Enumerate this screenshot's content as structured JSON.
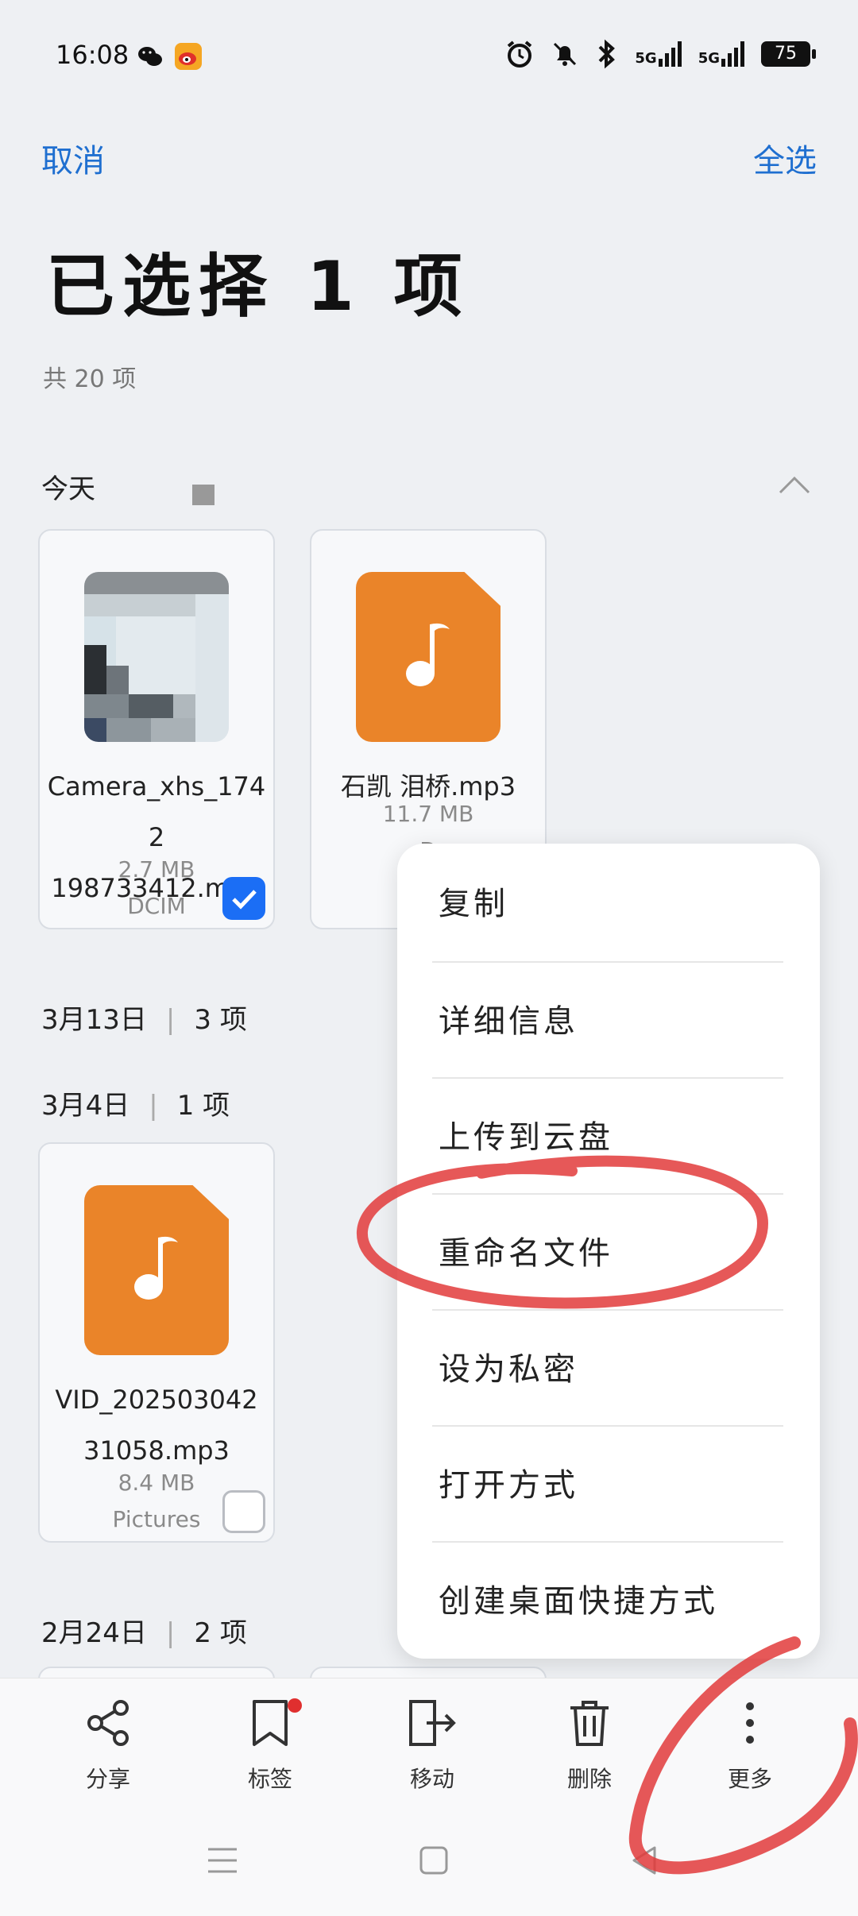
{
  "status_bar": {
    "time": "16:08",
    "battery": "75",
    "signal_1": "5G",
    "signal_2": "5G",
    "icons": [
      "wechat-icon",
      "weibo-icon",
      "alarm-icon",
      "mute-icon",
      "bluetooth-icon",
      "signal-icon",
      "signal-icon",
      "battery-icon"
    ]
  },
  "header": {
    "cancel_label": "取消",
    "select_all_label": "全选",
    "title": "已选择 1 项",
    "subtitle": "共 20 项"
  },
  "sections": [
    {
      "label": "今天",
      "files": [
        {
          "name": "Camera_xhs_1742198733412.mp4",
          "name_line1": "Camera_xhs_1742",
          "name_line2": "198733412.mp4",
          "size": "2.7 MB",
          "location": "DCIM",
          "selected": true,
          "thumb": "video-thumbnail"
        },
        {
          "name": "石凯 泪桥.mp3",
          "name_line1": "石凯 泪桥.mp3",
          "size": "11.7 MB",
          "location": "D",
          "selected": false,
          "thumb": "music-file-icon"
        }
      ]
    },
    {
      "label": "3月13日",
      "count": "3 项"
    },
    {
      "label": "3月4日",
      "count": "1 项",
      "files": [
        {
          "name": "VID_20250304231058.mp3",
          "name_line1": "VID_202503042",
          "name_line2": "31058.mp3",
          "size": "8.4 MB",
          "location": "Pictures",
          "selected": false,
          "thumb": "music-file-icon"
        }
      ]
    },
    {
      "label": "2月24日",
      "count": "2 项"
    }
  ],
  "context_menu": {
    "items": [
      "复制",
      "详细信息",
      "上传到云盘",
      "重命名文件",
      "设为私密",
      "打开方式",
      "创建桌面快捷方式"
    ]
  },
  "toolbar": {
    "share_label": "分享",
    "tag_label": "标签",
    "move_label": "移动",
    "delete_label": "删除",
    "more_label": "更多"
  },
  "colors": {
    "accent": "#1f6fd0",
    "checkbox": "#1b6ef5",
    "music_icon": "#ea8429",
    "annotation": "#e23b3b"
  }
}
